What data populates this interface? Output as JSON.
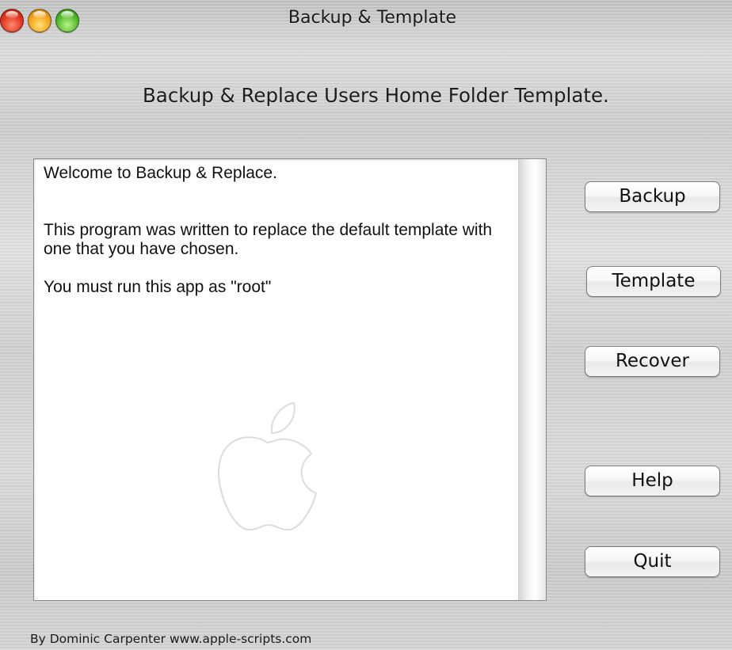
{
  "window": {
    "title": "Backup & Template"
  },
  "heading": "Backup & Replace Users Home Folder Template.",
  "text_panel": {
    "lines": [
      "Welcome to Backup & Replace.",
      "This program was written to replace the default template with one that you have chosen.",
      "You must run this app as \"root\""
    ]
  },
  "buttons": {
    "backup": "Backup",
    "template": "Template",
    "recover": "Recover",
    "help": "Help",
    "quit": "Quit"
  },
  "footer": "By Dominic Carpenter www.apple-scripts.com",
  "icons": {
    "traffic_lights": [
      "close-icon",
      "minimize-icon",
      "zoom-icon"
    ],
    "watermark": "apple-logo-icon"
  },
  "colors": {
    "close": "#e0341e",
    "minimize": "#f3a21b",
    "zoom": "#55b82b",
    "panel_background": "#ffffff"
  }
}
